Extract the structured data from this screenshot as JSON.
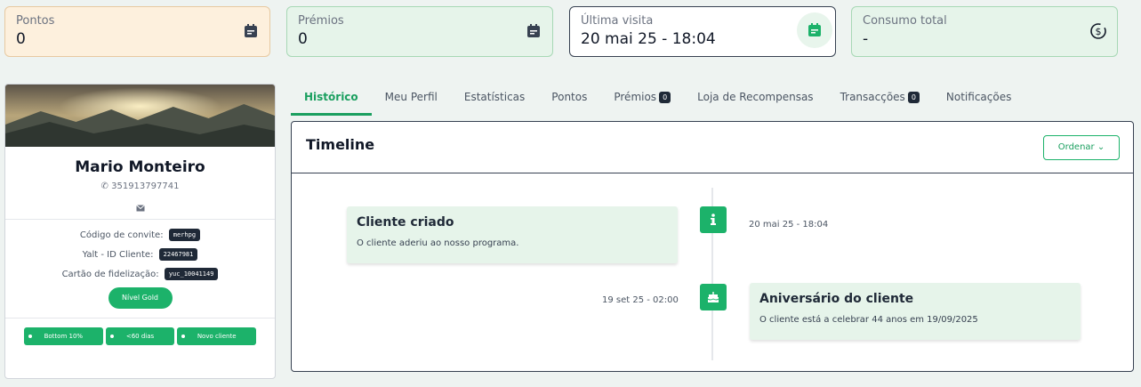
{
  "stats": {
    "pontos": {
      "label": "Pontos",
      "value": "0",
      "icon": "calendar-icon"
    },
    "premios": {
      "label": "Prémios",
      "value": "0",
      "icon": "calendar-icon"
    },
    "ultima_visita": {
      "label": "Última visita",
      "value": "20 mai 25 - 18:04",
      "icon": "calendar-edit-icon"
    },
    "consumo_total": {
      "label": "Consumo total",
      "value": "-",
      "icon": "dollar-refresh-icon"
    }
  },
  "profile": {
    "name": "Mario Monteiro",
    "phone": "351913797741",
    "invite_label": "Código de convite:",
    "invite_code": "merhpg",
    "client_id_label": "Yalt - ID Cliente:",
    "client_id": "22467981",
    "card_label": "Cartão de fidelização:",
    "card_value": "yuc_10041149",
    "level": "Nível Gold",
    "tags": [
      "Bottom 10%",
      "<60 dias",
      "Novo cliente"
    ]
  },
  "tabs": [
    {
      "label": "Histórico",
      "active": true
    },
    {
      "label": "Meu Perfil"
    },
    {
      "label": "Estatísticas"
    },
    {
      "label": "Pontos"
    },
    {
      "label": "Prémios",
      "count": "0"
    },
    {
      "label": "Loja de Recompensas"
    },
    {
      "label": "Transacções",
      "count": "0"
    },
    {
      "label": "Notificações"
    }
  ],
  "timeline": {
    "title": "Timeline",
    "order_label": "Ordenar",
    "events": [
      {
        "title": "Cliente criado",
        "text": "O cliente aderiu ao nosso programa.",
        "date": "20 mai 25 - 18:04",
        "icon": "info-icon"
      },
      {
        "title": "Aniversário do cliente",
        "text": "O cliente está a celebrar 44 anos em 19/09/2025",
        "date": "19 set 25 - 02:00",
        "icon": "cake-icon"
      }
    ]
  },
  "colors": {
    "accent": "#1cb26a",
    "dark": "#1f2937"
  }
}
